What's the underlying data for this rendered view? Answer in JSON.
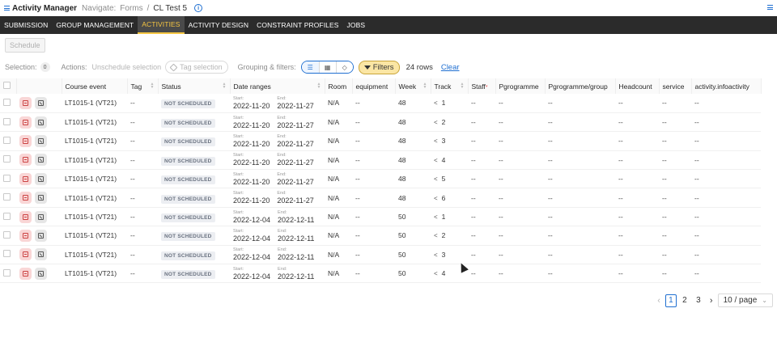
{
  "app": {
    "title": "Activity Manager",
    "navigate_label": "Navigate:",
    "breadcrumbs": [
      "Forms",
      "CL Test 5"
    ]
  },
  "nav_tabs": [
    {
      "label": "SUBMISSION",
      "active": false
    },
    {
      "label": "GROUP MANAGEMENT",
      "active": false
    },
    {
      "label": "ACTIVITIES",
      "active": true
    },
    {
      "label": "ACTIVITY DESIGN",
      "active": false
    },
    {
      "label": "CONSTRAINT PROFILES",
      "active": false
    },
    {
      "label": "JOBS",
      "active": false
    }
  ],
  "toolbar": {
    "schedule_label": "Schedule",
    "selection_label": "Selection:",
    "selection_count": "0",
    "actions_label": "Actions:",
    "unschedule_label": "Unschedule selection",
    "tag_label": "Tag selection",
    "grouping_label": "Grouping & filters:",
    "filters_label": "Filters",
    "rows_count": "24 rows",
    "clear_label": "Clear"
  },
  "table": {
    "columns": [
      "Course event",
      "Tag",
      "Status",
      "Date ranges",
      "Room",
      "equipment",
      "Week",
      "Track",
      "Staff",
      "Pgrogramme",
      "Pgrogramme/group",
      "Headcount",
      "service",
      "activity.infoactivity"
    ],
    "start_label": "Start:",
    "end_label": "End:",
    "rows": [
      {
        "course": "LT1015-1 (VT21)",
        "tag": "--",
        "status": "NOT SCHEDULED",
        "start": "2022-11-20",
        "end": "2022-11-27",
        "room": "N/A",
        "equipment": "--",
        "week": "48",
        "track": "1",
        "staff": "--",
        "programme": "--",
        "programme_group": "--",
        "headcount": "--",
        "service": "--",
        "info": "--"
      },
      {
        "course": "LT1015-1 (VT21)",
        "tag": "--",
        "status": "NOT SCHEDULED",
        "start": "2022-11-20",
        "end": "2022-11-27",
        "room": "N/A",
        "equipment": "--",
        "week": "48",
        "track": "2",
        "staff": "--",
        "programme": "--",
        "programme_group": "--",
        "headcount": "--",
        "service": "--",
        "info": "--"
      },
      {
        "course": "LT1015-1 (VT21)",
        "tag": "--",
        "status": "NOT SCHEDULED",
        "start": "2022-11-20",
        "end": "2022-11-27",
        "room": "N/A",
        "equipment": "--",
        "week": "48",
        "track": "3",
        "staff": "--",
        "programme": "--",
        "programme_group": "--",
        "headcount": "--",
        "service": "--",
        "info": "--"
      },
      {
        "course": "LT1015-1 (VT21)",
        "tag": "--",
        "status": "NOT SCHEDULED",
        "start": "2022-11-20",
        "end": "2022-11-27",
        "room": "N/A",
        "equipment": "--",
        "week": "48",
        "track": "4",
        "staff": "--",
        "programme": "--",
        "programme_group": "--",
        "headcount": "--",
        "service": "--",
        "info": "--"
      },
      {
        "course": "LT1015-1 (VT21)",
        "tag": "--",
        "status": "NOT SCHEDULED",
        "start": "2022-11-20",
        "end": "2022-11-27",
        "room": "N/A",
        "equipment": "--",
        "week": "48",
        "track": "5",
        "staff": "--",
        "programme": "--",
        "programme_group": "--",
        "headcount": "--",
        "service": "--",
        "info": "--"
      },
      {
        "course": "LT1015-1 (VT21)",
        "tag": "--",
        "status": "NOT SCHEDULED",
        "start": "2022-11-20",
        "end": "2022-11-27",
        "room": "N/A",
        "equipment": "--",
        "week": "48",
        "track": "6",
        "staff": "--",
        "programme": "--",
        "programme_group": "--",
        "headcount": "--",
        "service": "--",
        "info": "--"
      },
      {
        "course": "LT1015-1 (VT21)",
        "tag": "--",
        "status": "NOT SCHEDULED",
        "start": "2022-12-04",
        "end": "2022-12-11",
        "room": "N/A",
        "equipment": "--",
        "week": "50",
        "track": "1",
        "staff": "--",
        "programme": "--",
        "programme_group": "--",
        "headcount": "--",
        "service": "--",
        "info": "--"
      },
      {
        "course": "LT1015-1 (VT21)",
        "tag": "--",
        "status": "NOT SCHEDULED",
        "start": "2022-12-04",
        "end": "2022-12-11",
        "room": "N/A",
        "equipment": "--",
        "week": "50",
        "track": "2",
        "staff": "--",
        "programme": "--",
        "programme_group": "--",
        "headcount": "--",
        "service": "--",
        "info": "--"
      },
      {
        "course": "LT1015-1 (VT21)",
        "tag": "--",
        "status": "NOT SCHEDULED",
        "start": "2022-12-04",
        "end": "2022-12-11",
        "room": "N/A",
        "equipment": "--",
        "week": "50",
        "track": "3",
        "staff": "--",
        "programme": "--",
        "programme_group": "--",
        "headcount": "--",
        "service": "--",
        "info": "--"
      },
      {
        "course": "LT1015-1 (VT21)",
        "tag": "--",
        "status": "NOT SCHEDULED",
        "start": "2022-12-04",
        "end": "2022-12-11",
        "room": "N/A",
        "equipment": "--",
        "week": "50",
        "track": "4",
        "staff": "--",
        "programme": "--",
        "programme_group": "--",
        "headcount": "--",
        "service": "--",
        "info": "--"
      }
    ]
  },
  "pagination": {
    "pages": [
      "1",
      "2",
      "3"
    ],
    "current": "1",
    "page_size": "10 / page"
  },
  "colors": {
    "accent": "#1f6fd1",
    "nav_bg": "#2b2b2b",
    "active_tab": "#f5c542",
    "filters_bg": "#fbe6a4"
  }
}
